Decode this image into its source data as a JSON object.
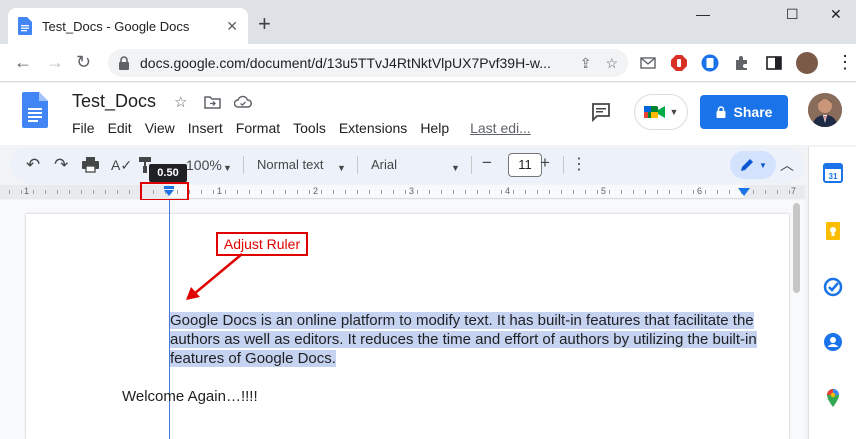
{
  "browser": {
    "tab_title": "Test_Docs - Google Docs",
    "tab_close": "✕",
    "new_tab": "+",
    "window_controls": {
      "minimize": "—",
      "maximize": "☐",
      "close": "✕"
    },
    "url": "docs.google.com/document/d/13u5TTvJ4RtNktVlpUX7Pvf39H-w..."
  },
  "docs": {
    "title": "Test_Docs",
    "menu": [
      "File",
      "Edit",
      "View",
      "Insert",
      "Format",
      "Tools",
      "Extensions",
      "Help"
    ],
    "last_edit": "Last edi...",
    "share_label": "Share"
  },
  "toolbar": {
    "zoom": "100%",
    "style": "Normal text",
    "font": "Arial",
    "font_size": "11",
    "minus": "−",
    "plus": "+",
    "more": "⋮"
  },
  "ruler": {
    "tooltip": "0.50",
    "numbers": [
      "1",
      "1",
      "2",
      "3",
      "4",
      "5",
      "6",
      "7"
    ]
  },
  "document": {
    "paragraph_lines": [
      "Google Docs is an online platform to modify text. It has built-in features that facilitate the",
      "authors as well as editors. It reduces the time and effort of authors by utilizing the built-in",
      "features of Google Docs."
    ],
    "welcome": "Welcome Again…!!!!"
  },
  "annotation": {
    "label": "Adjust Ruler"
  },
  "colors": {
    "accent": "#1a73e8",
    "annotation": "#e00000",
    "selection": "#c5d3f1"
  }
}
